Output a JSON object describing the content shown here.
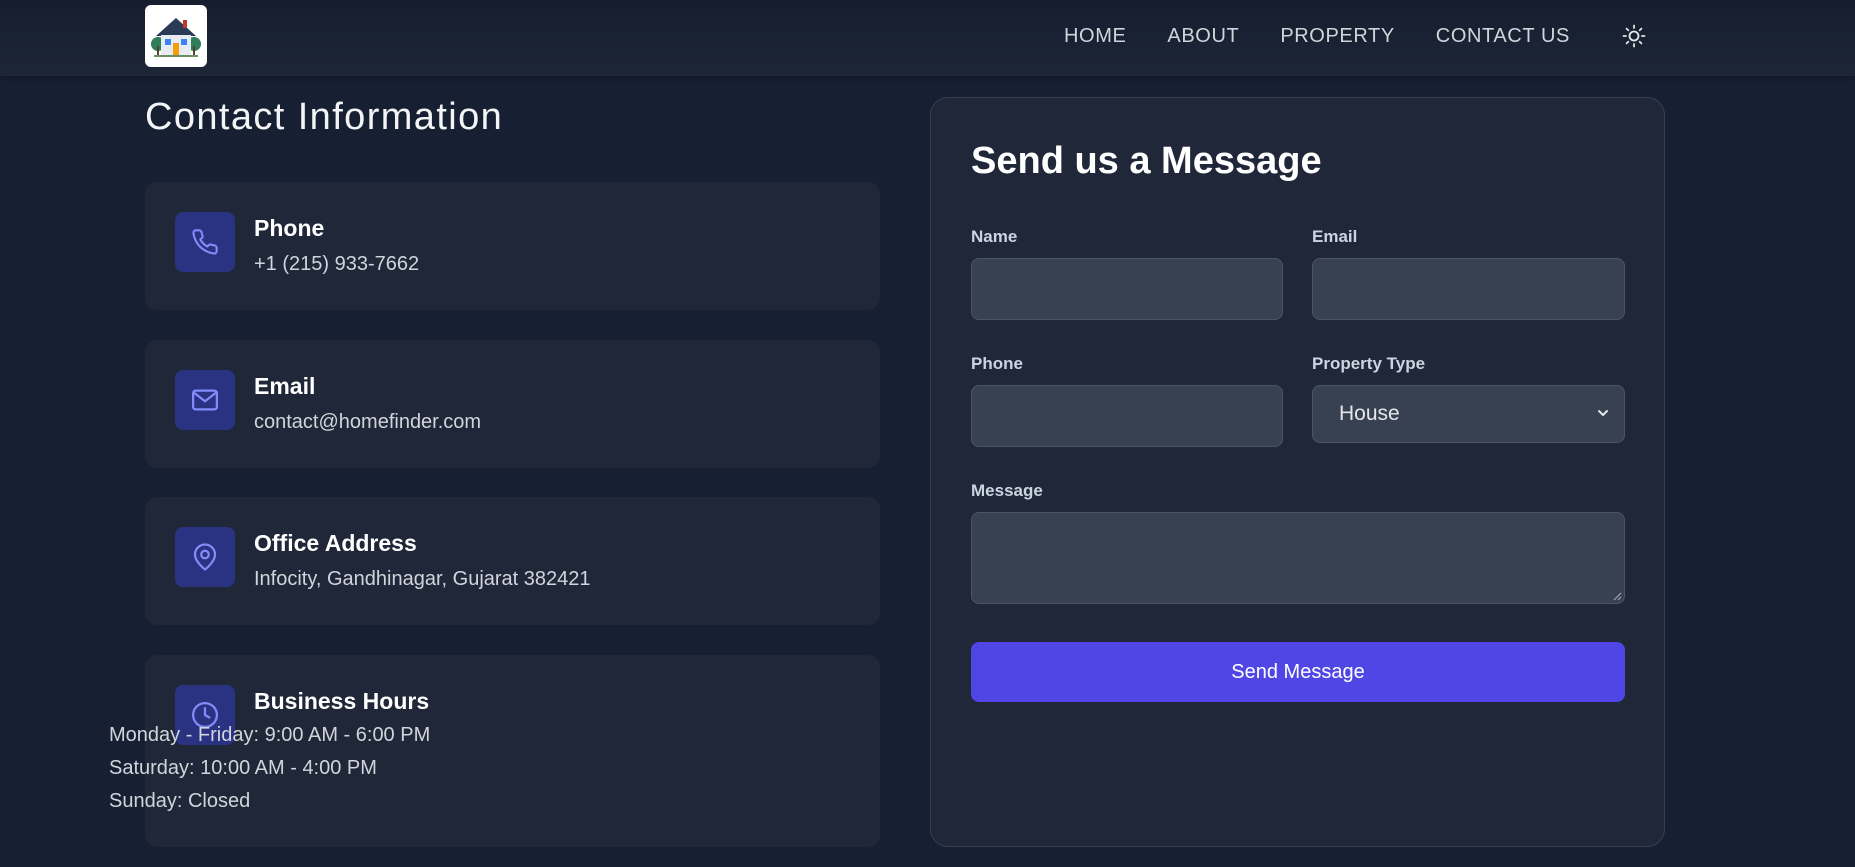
{
  "header": {
    "logo": "house-logo",
    "nav": {
      "home": "HOME",
      "about": "ABOUT",
      "property": "PROPERTY",
      "contact": "CONTACT US"
    },
    "theme_icon": "sun-icon"
  },
  "contact_info": {
    "title": "Contact Information",
    "cards": {
      "phone": {
        "icon": "phone-icon",
        "label": "Phone",
        "value": "+1 (215) 933-7662"
      },
      "email": {
        "icon": "mail-icon",
        "label": "Email",
        "value": "contact@homefinder.com"
      },
      "address": {
        "icon": "map-pin-icon",
        "label": "Office Address",
        "value": "Infocity, Gandhinagar, Gujarat 382421"
      },
      "hours": {
        "icon": "clock-icon",
        "label": "Business Hours",
        "lines": [
          "Monday - Friday: 9:00 AM - 6:00 PM",
          "Saturday: 10:00 AM - 4:00 PM",
          "Sunday: Closed"
        ]
      }
    }
  },
  "form": {
    "title": "Send us a Message",
    "name_label": "Name",
    "email_label": "Email",
    "phone_label": "Phone",
    "property_type_label": "Property Type",
    "property_type_value": "House",
    "message_label": "Message",
    "submit_label": "Send Message"
  },
  "colors": {
    "background": "#172033",
    "card": "#1f2738",
    "icon_box": "#2a3382",
    "accent": "#4f46e5",
    "input": "#374151"
  }
}
